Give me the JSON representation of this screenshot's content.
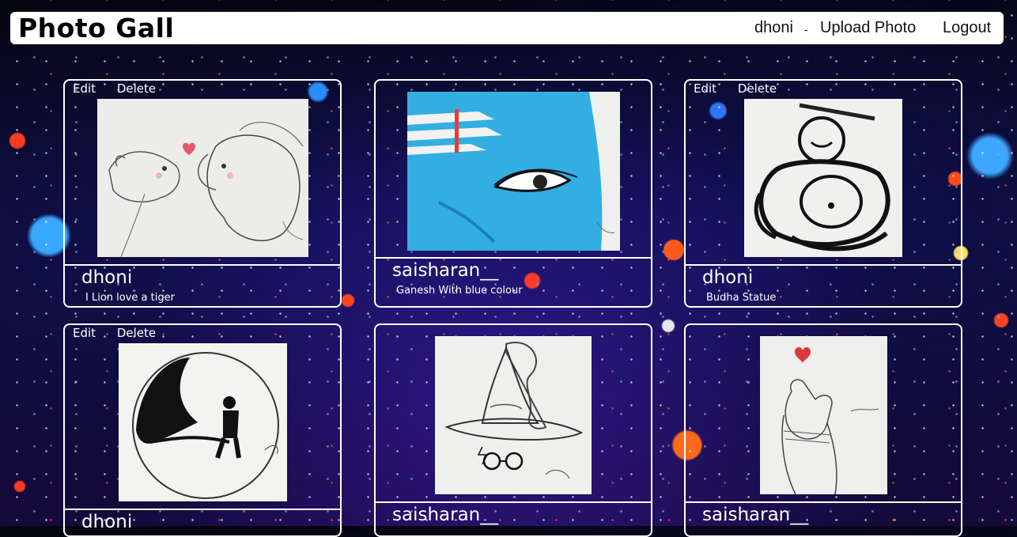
{
  "navbar": {
    "brand": "Photo Gall",
    "user": "dhoni",
    "separator": "-",
    "upload": "Upload Photo",
    "logout": "Logout"
  },
  "cards": [
    {
      "owner": "dhoni",
      "caption": "I Lion love a tiger",
      "edit": "Edit",
      "delete": "Delete",
      "artwork_icon": "lion-sketch-icon"
    },
    {
      "owner": "saisharan__",
      "caption": "Ganesh With blue colour",
      "artwork_icon": "blue-ganesh-painting-icon"
    },
    {
      "owner": "dhoni",
      "caption": "Budha Statue",
      "edit": "Edit",
      "delete": "Delete",
      "artwork_icon": "buddha-sketch-icon"
    },
    {
      "owner": "dhoni",
      "caption": "",
      "edit": "Edit",
      "delete": "Delete",
      "artwork_icon": "moon-silhouette-sketch-icon"
    },
    {
      "owner": "saisharan__",
      "caption": "",
      "artwork_icon": "sorting-hat-sketch-icon"
    },
    {
      "owner": "saisharan__",
      "caption": "",
      "artwork_icon": "finger-heart-sketch-icon"
    }
  ],
  "colors": {
    "card_border": "#ffffff",
    "navbar_bg": "#ffffff",
    "page_bg": "#0b0b2a"
  }
}
